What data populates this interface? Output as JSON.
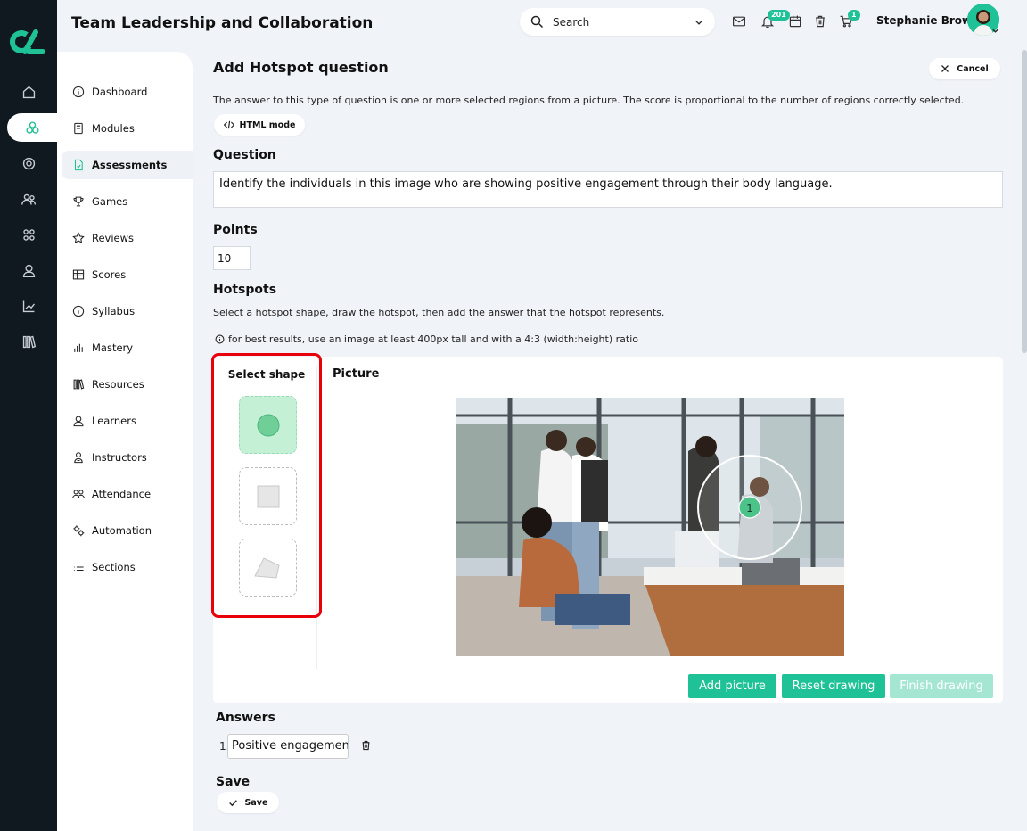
{
  "app": {
    "title": "Team Leadership and Collaboration"
  },
  "topbar": {
    "search_placeholder": "Search",
    "notifications_count": "201",
    "cart_count": "1",
    "user_name": "Stephanie Brown"
  },
  "sidebar": {
    "items": [
      {
        "label": "Dashboard",
        "icon": "info-icon"
      },
      {
        "label": "Modules",
        "icon": "book-icon"
      },
      {
        "label": "Assessments",
        "icon": "file-icon",
        "active": true
      },
      {
        "label": "Games",
        "icon": "trophy-icon"
      },
      {
        "label": "Reviews",
        "icon": "star-icon"
      },
      {
        "label": "Scores",
        "icon": "table-icon"
      },
      {
        "label": "Syllabus",
        "icon": "info-icon"
      },
      {
        "label": "Mastery",
        "icon": "bars-icon"
      },
      {
        "label": "Resources",
        "icon": "books-icon"
      },
      {
        "label": "Learners",
        "icon": "user-icon"
      },
      {
        "label": "Instructors",
        "icon": "instructor-icon"
      },
      {
        "label": "Attendance",
        "icon": "group-icon"
      },
      {
        "label": "Automation",
        "icon": "gears-icon"
      },
      {
        "label": "Sections",
        "icon": "list-icon"
      }
    ]
  },
  "form": {
    "heading": "Add Hotspot question",
    "cancel_label": "Cancel",
    "description": "The answer to this type of question is one or more selected regions from a picture. The score is proportional to the number of regions correctly selected.",
    "html_mode_label": "HTML mode",
    "question_label": "Question",
    "question_value": "Identify the individuals in this image who are showing positive engagement through their body language.",
    "points_label": "Points",
    "points_value": "10",
    "hotspots_label": "Hotspots",
    "hotspots_help": "Select a hotspot shape, draw the hotspot, then add the answer that the hotspot represents.",
    "tip": "for best results, use an image at least 400px tall and with a 4:3 (width:height) ratio",
    "select_shape_label": "Select shape",
    "picture_label": "Picture",
    "hotspot_marker": "1",
    "add_picture_label": "Add picture",
    "reset_drawing_label": "Reset drawing",
    "finish_drawing_label": "Finish drawing",
    "answers_label": "Answers",
    "answers": [
      {
        "index": "1.",
        "value": "Positive engagement"
      }
    ],
    "save_heading": "Save",
    "save_label": "Save"
  },
  "colors": {
    "accent": "#1fc196",
    "rail": "#101820",
    "highlight": "#e8000b"
  }
}
